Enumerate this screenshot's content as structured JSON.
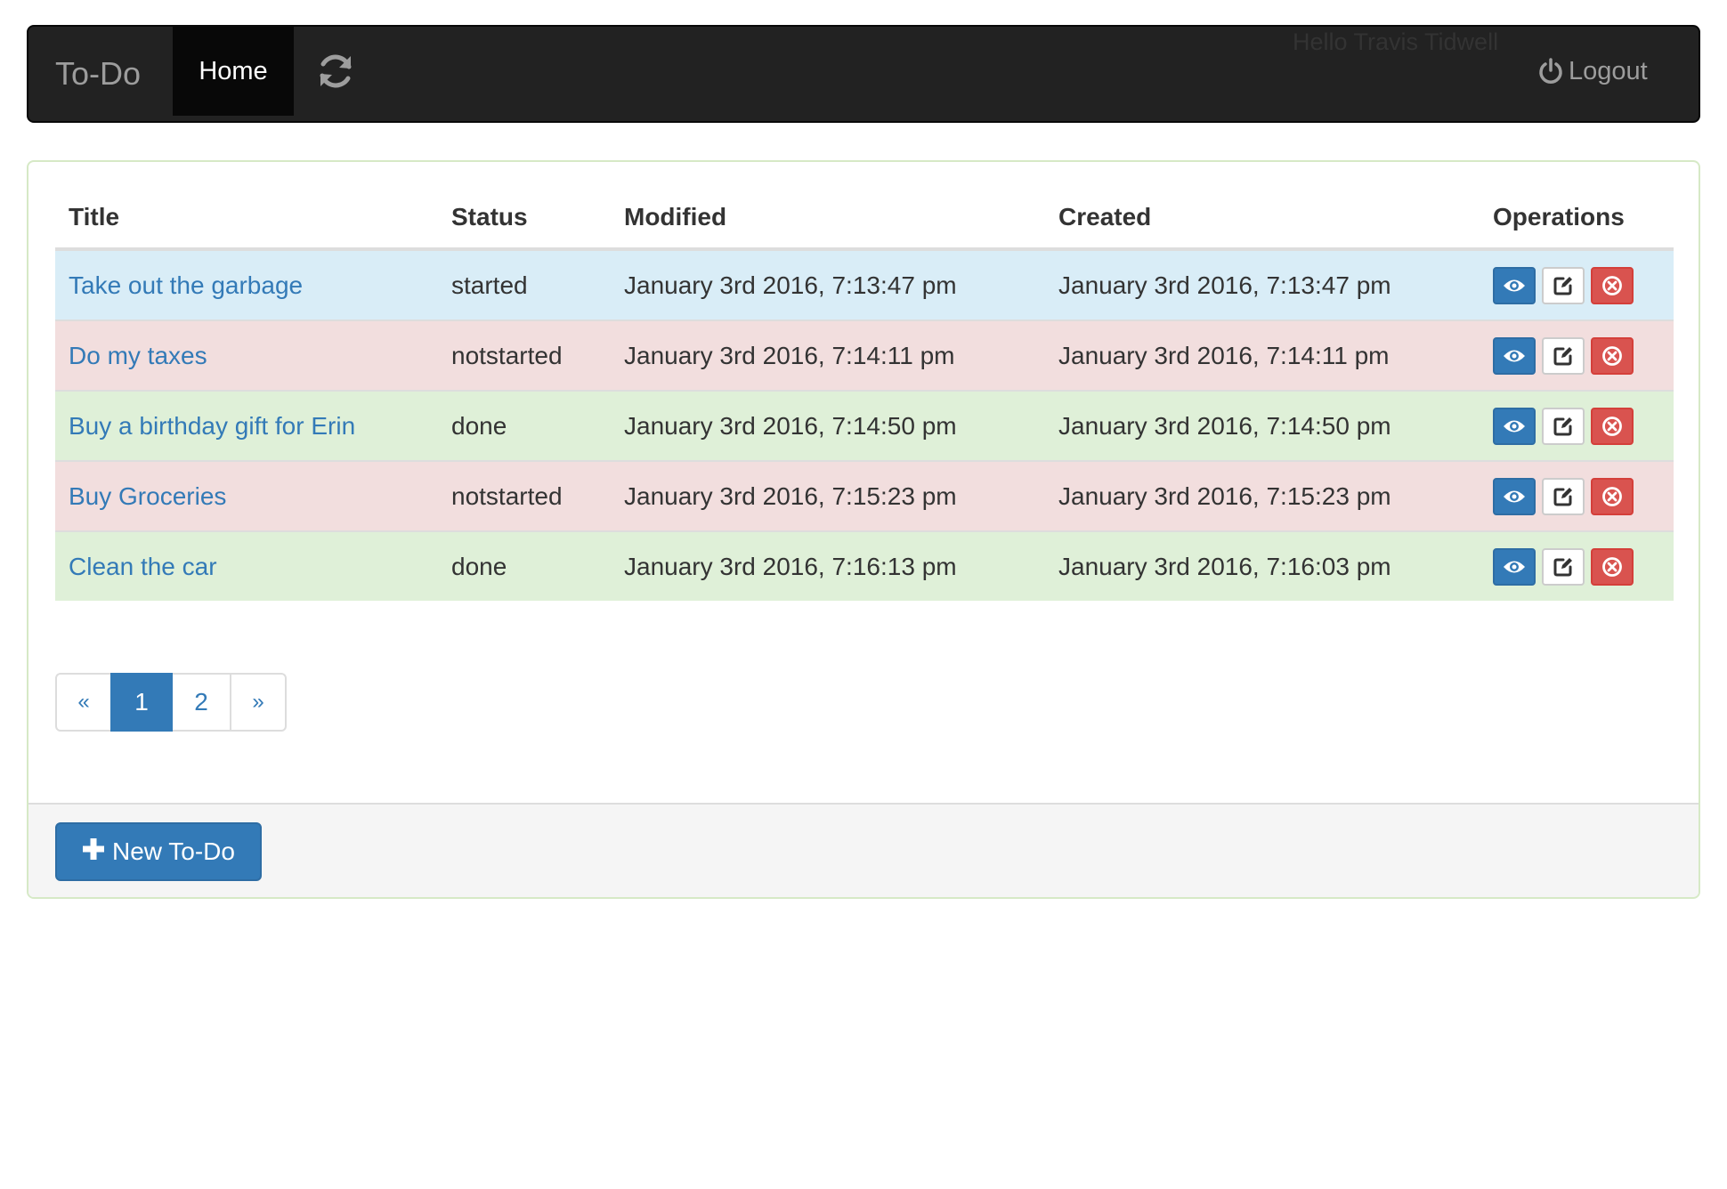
{
  "navbar": {
    "brand": "To-Do",
    "home_label": "Home",
    "refresh_icon": "refresh-icon",
    "greeting": "Hello Travis Tidwell",
    "logout_label": "Logout",
    "logout_icon": "power-icon"
  },
  "table": {
    "headers": {
      "title": "Title",
      "status": "Status",
      "modified": "Modified",
      "created": "Created",
      "operations": "Operations"
    },
    "rows": [
      {
        "title": "Take out the garbage",
        "status": "started",
        "modified": "January 3rd 2016, 7:13:47 pm",
        "created": "January 3rd 2016, 7:13:47 pm",
        "row_color": "#d9edf7"
      },
      {
        "title": "Do my taxes",
        "status": "notstarted",
        "modified": "January 3rd 2016, 7:14:11 pm",
        "created": "January 3rd 2016, 7:14:11 pm",
        "row_color": "#f2dede"
      },
      {
        "title": "Buy a birthday gift for Erin",
        "status": "done",
        "modified": "January 3rd 2016, 7:14:50 pm",
        "created": "January 3rd 2016, 7:14:50 pm",
        "row_color": "#dff0d8"
      },
      {
        "title": "Buy Groceries",
        "status": "notstarted",
        "modified": "January 3rd 2016, 7:15:23 pm",
        "created": "January 3rd 2016, 7:15:23 pm",
        "row_color": "#f2dede"
      },
      {
        "title": "Clean the car",
        "status": "done",
        "modified": "January 3rd 2016, 7:16:13 pm",
        "created": "January 3rd 2016, 7:16:03 pm",
        "row_color": "#dff0d8"
      }
    ],
    "operation_icons": [
      "eye-icon",
      "edit-icon",
      "remove-circle-icon"
    ]
  },
  "pagination": {
    "prev": "«",
    "pages": [
      "1",
      "2"
    ],
    "active_page": "1",
    "next": "»"
  },
  "footer": {
    "new_label": "New To-Do",
    "new_icon": "plus-icon"
  },
  "colors": {
    "primary": "#337ab7",
    "danger": "#d9534f",
    "navbar": "#222222",
    "panel_border": "#d6e9c6"
  }
}
